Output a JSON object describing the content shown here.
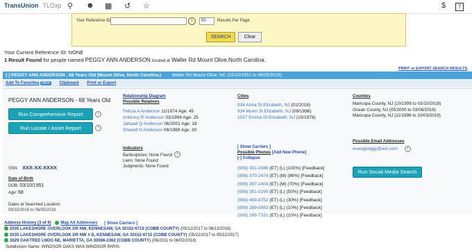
{
  "topbar": {
    "brand": "TransUnion",
    "product": "TLOxp",
    "dollar": "$",
    "help": "?"
  },
  "search": {
    "ref_label": "Your Reference ID:",
    "results_label": "Results Per Page",
    "results_value": "50",
    "search_btn": "SEARCH",
    "clear_btn": "Clear"
  },
  "summary": {
    "ref_line": "Your Current Reference ID: NONE",
    "found_prefix": "1 Result Found",
    "found_mid": "for people named",
    "name": "PEGGY ANN ANDERSON",
    "located": "located at",
    "location": "Waller Rd Mount Olive,North Carolina."
  },
  "export_link": "PRINT or EXPORT SEARCH RESULTS",
  "header": {
    "title": "[-] PEGGY ANN ANDERSON , 68 Years Old (Mount Olive, North Carolina.)",
    "addr": "Waller Rd Mount Olive, NC (03/10/1951 to 06/05/2019)"
  },
  "subheader": {
    "favorites": "Add To Favorites",
    "new": "NEW",
    "clipboard": "Clipboard",
    "print": "Print or Export"
  },
  "person": {
    "name_age": "PEGGY ANN ANDERSON - 68 Years Old",
    "report1": "Run Comprehensive Report",
    "report2": "Run Locate / Asset Report",
    "ssn_label": "SSN:",
    "ssn_value": "XXX-XX-XXXX",
    "dob_head": "Date of Birth",
    "dob_label": "DOB:",
    "dob_value": "03/10/1951",
    "age_label": "Age:",
    "age_value": "68",
    "searched_label": "Dates at Searched Location:",
    "searched_value": "09/15/2016 to 06/05/2019"
  },
  "relationship": {
    "head1": "Relationship Diagram",
    "head2": "Possible Relatives",
    "rows": [
      {
        "name": "Felicia A Anderson",
        "dob": "11/1974",
        "age": "Age: 45"
      },
      {
        "name": "Anthony R Anderson",
        "dob": "03/1994",
        "age": "Age: 25"
      },
      {
        "name": "Jahaad Q Anderson",
        "dob": "06/2001",
        "age": "Age: 18"
      },
      {
        "name": "Shavell N Anderson",
        "dob": "08/1989",
        "age": "Age: 30"
      }
    ]
  },
  "indicators": {
    "head": "Indicators",
    "rows": [
      "Bankruptcies: None Found",
      "Liens: None Found",
      "Judgments: None Found"
    ]
  },
  "cities": {
    "head": "Cities",
    "rows": [
      {
        "city": "934 Anna St Elizabeth, NJ",
        "dates": "(01/2018)"
      },
      {
        "city": "934 Munn St Elizabeth, NJ",
        "dates": "(09/1996)"
      },
      {
        "city": "1027 Emma St Elizabeth, NJ",
        "dates": "(10/1978)"
      }
    ]
  },
  "counties": {
    "head": "Counties",
    "rows": [
      "Maricopa County, NJ (10/1999 to 03/10/2018)",
      "Ocean County, NJ (05/2000 to 03/06/2018)",
      "Maricopa County, NJ (11/1998 to 10/03/2019)"
    ]
  },
  "phones": {
    "show_carriers": "[ Show Carriers ]",
    "head": "Possible Phones",
    "add_new": "[Add New Phone]",
    "collapse": "[-] Collapse",
    "rows": [
      {
        "num": "(908) 351-3086",
        "meta": "(ET) (L) (100%)",
        "fb": "[Feedback]"
      },
      {
        "num": "(908) 370-2474",
        "meta": "(ET) (M) (86%)",
        "fb": "[Feedback]"
      },
      {
        "num": "(908) 397-1404",
        "meta": "(ET) (M) (70%)",
        "fb": "[Feedback]"
      },
      {
        "num": "(908) 351-0290",
        "meta": "(ET) (L) (50%)",
        "fb": "[Feedback]"
      },
      {
        "num": "(908) 469-8752",
        "meta": "(ET) (L) (30%)",
        "fb": "[Feedback]"
      },
      {
        "num": "(908) 289-5083",
        "meta": "(ET) (L) (10%)",
        "fb": "[Feedback]"
      },
      {
        "num": "(908) 289-7331",
        "meta": "(ET) (L) (10%)",
        "fb": "[Feedback]"
      }
    ]
  },
  "emails": {
    "head": "Possible Email Addresses",
    "value": "evangpeggy@aol.com",
    "social": "Run Social Media Search"
  },
  "address_history": {
    "head": "Address History (3 of 9)",
    "map": "Map All Addresses",
    "carriers": "[ Show Carriers ]",
    "rows": [
      {
        "addr": "2035 LAKESHORE OVERLOOK DR NW, KENNESAW, GA 30152-6715 (COBB COUNTY)",
        "dates": "(05/12/2017 to 06/13/2018)"
      },
      {
        "addr": "2035 LAKESHORE OVERLOOK DR NW # D, KENNESAW, GA 30152-6715 (COBB COUNTY)",
        "dates": "(05/22/2017 to 05/22/2017)"
      },
      {
        "addr": "3029 OAKTREE LNDG NE, MARIETTA, GA 30066-2362 (COBB COUNTY)",
        "dates": "(06/2011 to 06/02/2018)"
      }
    ],
    "subdivision": "Subdivision Name: WINDSOR OAKS WAS WINDSOR PARIS"
  }
}
